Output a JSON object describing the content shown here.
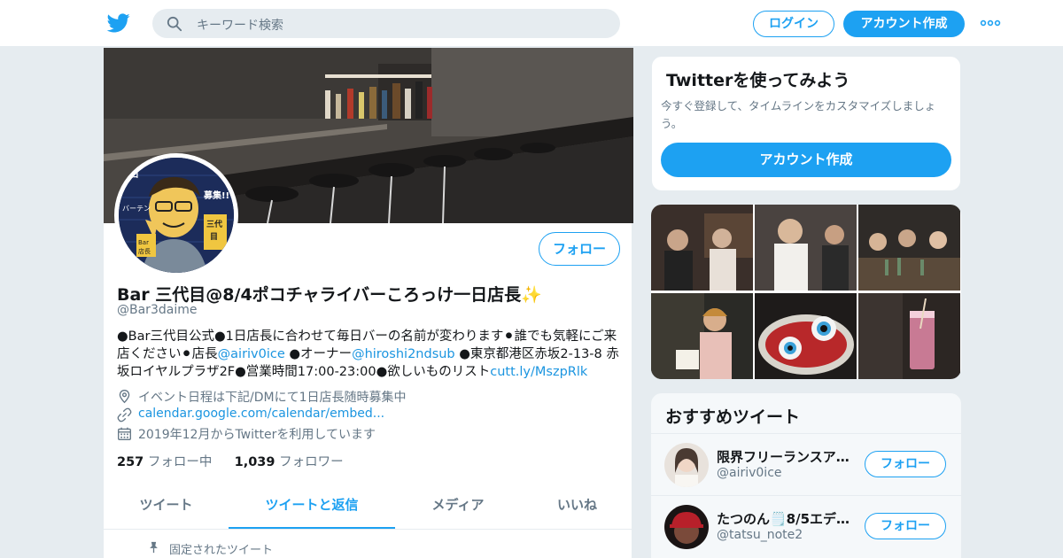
{
  "header": {
    "search_placeholder": "キーワード検索",
    "login_label": "ログイン",
    "signup_label": "アカウント作成"
  },
  "profile": {
    "name": "Bar 三代目@8/4ポコチャライバーころっけ一日店長✨",
    "handle": "@Bar3daime",
    "follow_label": "フォロー",
    "bio": {
      "part1": "●Bar三代目公式●1日店長に合わせて毎日バーの名前が変わります⚫誰でも気軽にご来店ください⚫店長",
      "link1": "@airiv0ice",
      "part2": " ●オーナー",
      "link2": "@hiroshi2ndsub",
      "part3": " ●東京都港区赤坂2-13-8 赤坂ロイヤルプラザ2F●営業時間17:00-23:00●欲しいものリスト",
      "link3": "cutt.ly/MszpRlk"
    },
    "location": "イベント日程は下記/DMにて1日店長随時募集中",
    "url": "calendar.google.com/calendar/embed...",
    "joined": "2019年12月からTwitterを利用しています",
    "following_count": "257",
    "following_label": "フォロー中",
    "followers_count": "1,039",
    "followers_label": "フォロワー",
    "avatar_lettering": [
      "1日",
      "バーテン",
      "募集!!",
      "三代目",
      "Bar",
      "店長"
    ]
  },
  "tabs": [
    {
      "label": "ツイート",
      "active": false
    },
    {
      "label": "ツイートと返信",
      "active": true
    },
    {
      "label": "メディア",
      "active": false
    },
    {
      "label": "いいね",
      "active": false
    }
  ],
  "pinned_label": "固定されたツイート",
  "signup_card": {
    "title": "Twitterを使ってみよう",
    "text": "今すぐ登録して、タイムラインをカスタマイズしましょう。",
    "button": "アカウント作成"
  },
  "recommendations": {
    "title": "おすすめツイート",
    "follow_label": "フォロー",
    "items": [
      {
        "name": "限界フリーランスア…",
        "handle": "@airiv0ice"
      },
      {
        "name": "たつのん🗒️8/5エデ…",
        "handle": "@tatsu_note2"
      }
    ]
  },
  "colors": {
    "accent": "#1da1f2",
    "link": "#1b95e0",
    "background": "#e6ecf0"
  },
  "icons": {
    "logo": "twitter-bird-icon",
    "search": "search-icon",
    "more": "more-dots-icon",
    "location": "location-pin-icon",
    "url": "link-icon",
    "joined": "calendar-icon",
    "pinned": "pin-icon"
  }
}
